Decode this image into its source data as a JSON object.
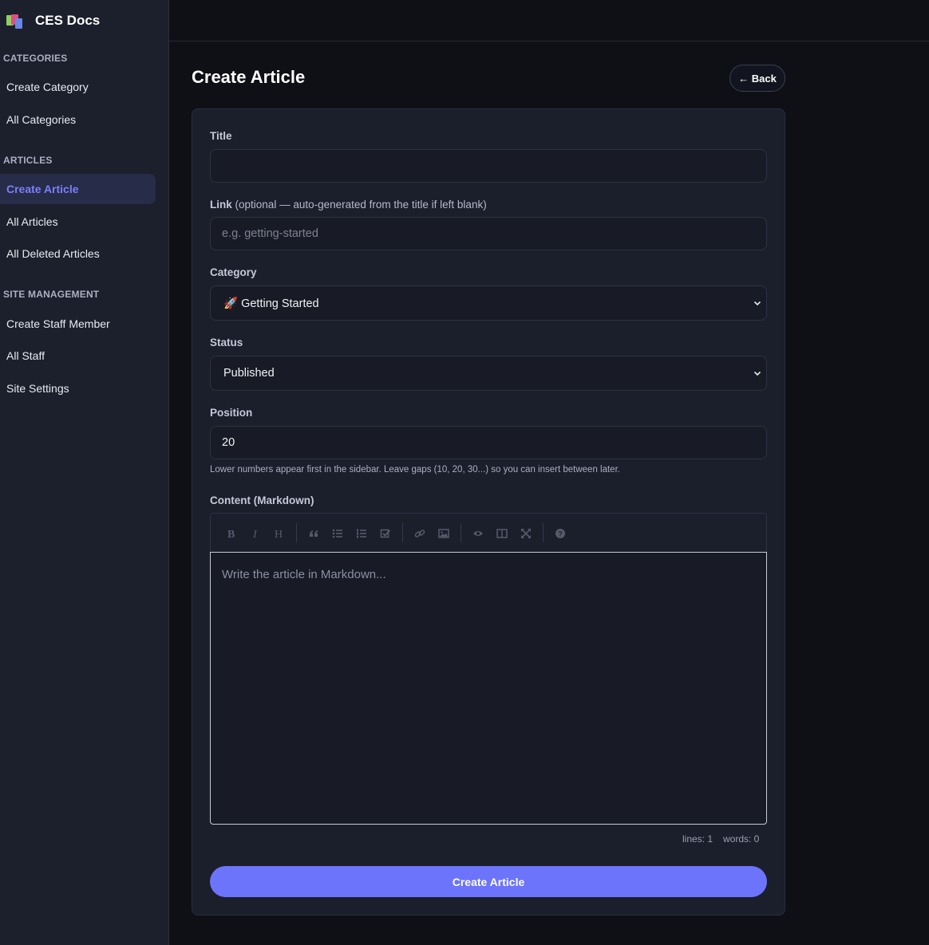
{
  "brand": {
    "name": "CES Docs"
  },
  "sidebar": {
    "sections": [
      {
        "title": "CATEGORIES",
        "items": [
          "Create Category",
          "All Categories"
        ]
      },
      {
        "title": "ARTICLES",
        "items": [
          "Create Article",
          "All Articles",
          "All Deleted Articles"
        ]
      },
      {
        "title": "SITE MANAGEMENT",
        "items": [
          "Create Staff Member",
          "All Staff",
          "Site Settings"
        ]
      }
    ],
    "active_item": "Create Article"
  },
  "header": {
    "title": "Create Article",
    "back_label": "← Back"
  },
  "form": {
    "title": {
      "label": "Title",
      "value": ""
    },
    "link": {
      "label": "Link",
      "label_note": "(optional — auto-generated from the title if left blank)",
      "placeholder": "e.g. getting-started"
    },
    "category": {
      "label": "Category",
      "selected": "🚀 Getting Started"
    },
    "status": {
      "label": "Status",
      "selected": "Published"
    },
    "position": {
      "label": "Position",
      "value": "20",
      "hint": "Lower numbers appear first in the sidebar. Leave gaps (10, 20, 30...) so you can insert between later."
    },
    "content": {
      "label": "Content (Markdown)",
      "placeholder": "Write the article in Markdown...",
      "toolbar": [
        "bold-icon",
        "italic-icon",
        "heading-icon",
        "quote-icon",
        "unordered-list-icon",
        "ordered-list-icon",
        "checklist-icon",
        "link-icon",
        "image-icon",
        "preview-icon",
        "side-by-side-icon",
        "fullscreen-icon",
        "help-icon"
      ],
      "status_lines": "lines: 1",
      "status_words": "words: 0"
    },
    "submit_label": "Create Article"
  },
  "colors": {
    "accent": "#6c74fb",
    "sidebar_bg": "#1c1f2c",
    "page_bg": "#0f1015",
    "card_bg": "#1b1e2b",
    "active_bg": "#272c48"
  }
}
